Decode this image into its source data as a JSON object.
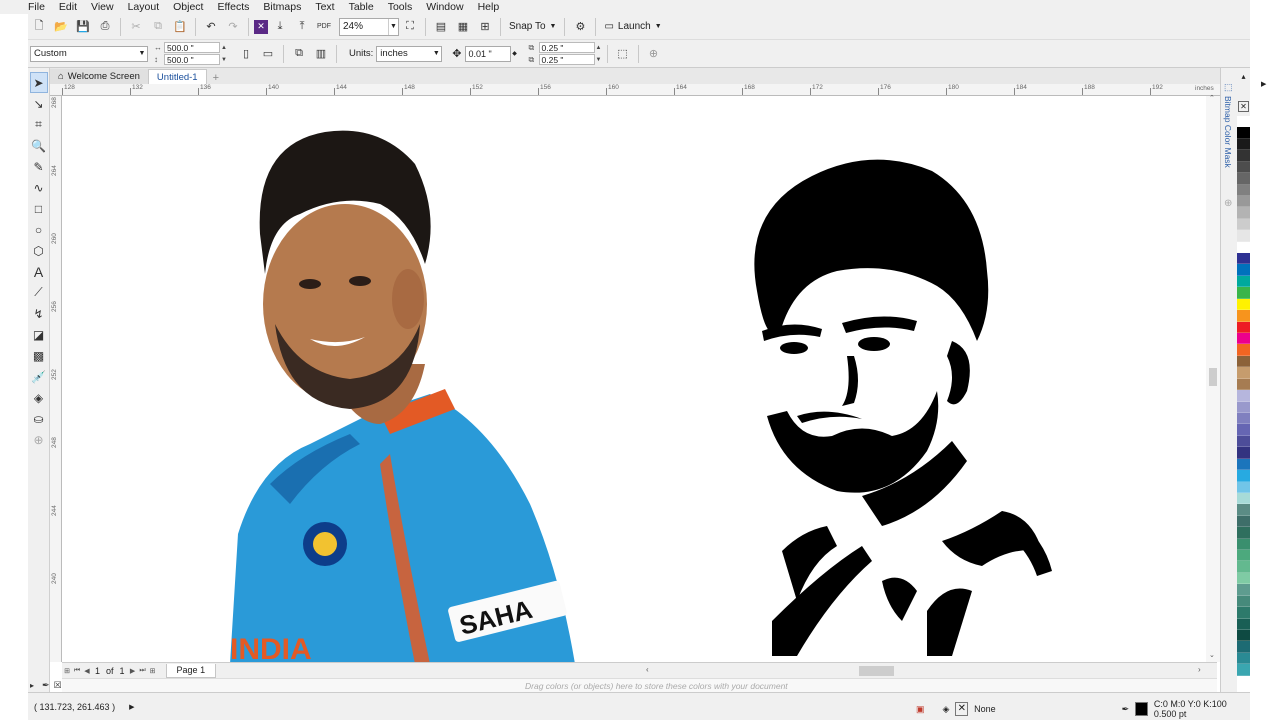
{
  "menu": [
    "File",
    "Edit",
    "View",
    "Layout",
    "Object",
    "Effects",
    "Bitmaps",
    "Text",
    "Table",
    "Tools",
    "Window",
    "Help"
  ],
  "toolbar": {
    "zoom": "24%",
    "snap_label": "Snap To",
    "launch_label": "Launch"
  },
  "property_bar": {
    "preset": "Custom",
    "width": "500.0 \"",
    "height": "500.0 \"",
    "units_label": "Units:",
    "units": "inches",
    "nudge": "0.01 \"",
    "dup_x": "0.25 \"",
    "dup_y": "0.25 \""
  },
  "tabs": [
    {
      "label": "Welcome Screen",
      "active": false
    },
    {
      "label": "Untitled-1",
      "active": true
    }
  ],
  "ruler": {
    "h_ticks": [
      "128",
      "132",
      "136",
      "140",
      "144",
      "148",
      "152",
      "156",
      "160",
      "164",
      "168",
      "172",
      "176",
      "180",
      "184",
      "188",
      "192"
    ],
    "h_unit": "inches",
    "v_ticks": [
      "268",
      "264",
      "260",
      "256",
      "252",
      "248",
      "244",
      "240"
    ]
  },
  "page_nav": {
    "current": "1",
    "of_label": "of",
    "total": "1",
    "page_tab": "Page 1"
  },
  "doc_palette_hint": "Drag colors (or objects) here to store these colors with your document",
  "docker_title": "Bitmap Color Mask",
  "status": {
    "coords": "( 131.723, 261.463 )",
    "fill_label": "None",
    "outline": "C:0 M:0 Y:0 K:100  0.500 pt"
  },
  "palette_colors": [
    "#ffffff",
    "#000000",
    "#1a1a1a",
    "#333333",
    "#4d4d4d",
    "#666666",
    "#808080",
    "#999999",
    "#b3b3b3",
    "#cccccc",
    "#e6e6e6",
    "#ffffff",
    "#2e3192",
    "#0071bc",
    "#00a99d",
    "#39b54a",
    "#fff200",
    "#f7941d",
    "#ed1c24",
    "#ec008c",
    "#f26522",
    "#8c6239",
    "#c69c6d",
    "#a67c52",
    "#b6b6dd",
    "#9999cc",
    "#8080bf",
    "#6666b3",
    "#4d4d99",
    "#333380",
    "#1b75bc",
    "#27aae1",
    "#71c5e8",
    "#a7dbd8",
    "#5b8c85",
    "#3e6e69",
    "#2f6f5e",
    "#3a8f6e",
    "#4ca97d",
    "#63b98f",
    "#7fcba4",
    "#5e9c8f",
    "#468a7b",
    "#2d7a6b",
    "#195f55",
    "#0e4a42",
    "#1d6b73",
    "#2a8a94",
    "#3aa6b0"
  ],
  "tools": [
    "pick-tool",
    "shape-tool",
    "crop-tool",
    "zoom-tool",
    "freehand-tool",
    "artistic-media-tool",
    "rectangle-tool",
    "ellipse-tool",
    "polygon-tool",
    "text-tool",
    "parallel-dimension-tool",
    "connector-tool",
    "drop-shadow-tool",
    "transparency-tool",
    "color-eyedropper-tool",
    "interactive-fill-tool",
    "smart-fill-tool",
    "add-tool"
  ]
}
